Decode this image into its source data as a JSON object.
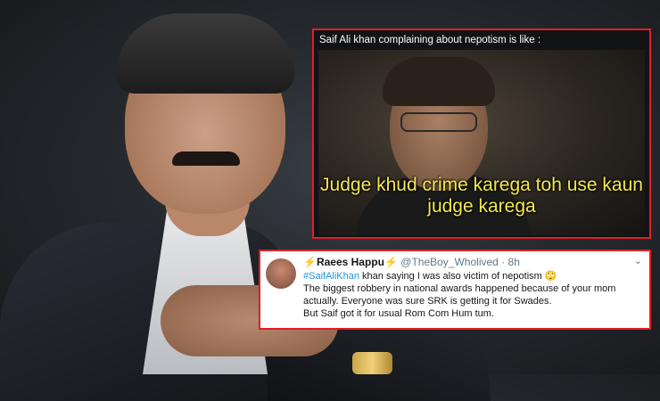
{
  "meme": {
    "caption": "Saif Ali khan complaining about nepotism is like :",
    "subtitle_line1": "Judge khud crime karega toh use kaun",
    "subtitle_line2": "judge karega"
  },
  "tweet": {
    "display_name": "⚡Raees Happu⚡",
    "handle": "@TheBoy_Wholived",
    "separator": " · ",
    "time": "8h",
    "chevron": "⌄",
    "hashtag": "#SaifAliKhan",
    "line1_rest": " khan saying I was also victim of nepotism 🙄",
    "line2": "The biggest robbery in national awards happened because of your mom",
    "line3": "actually. Everyone was sure SRK is getting it for Swades.",
    "line4": "But Saif got it for usual Rom Com Hum tum."
  },
  "colors": {
    "border_red": "#e01f26",
    "subtitle_yellow": "#f4e94a",
    "hashtag_blue": "#1b95e0"
  }
}
